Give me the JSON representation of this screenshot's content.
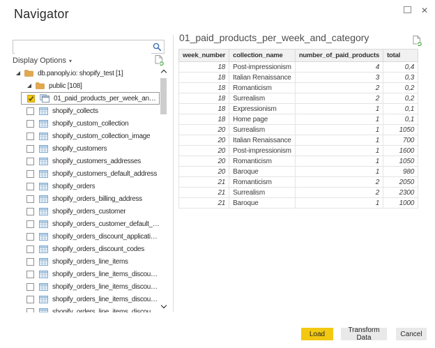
{
  "window": {
    "title": "Navigator",
    "close_glyph": "✕"
  },
  "search": {
    "value": "",
    "placeholder": ""
  },
  "left_panel": {
    "display_options_label": "Display Options",
    "display_options_caret": "▾",
    "tree": [
      {
        "label": "db.panoply.io: shopify_test [1]",
        "type": "folder",
        "level": 0,
        "expanded": true
      },
      {
        "label": "public [108]",
        "type": "folder",
        "level": 1,
        "expanded": true
      },
      {
        "label": "01_paid_products_per_week_and_cat...",
        "type": "view",
        "level": 2,
        "checked": true,
        "selected": true
      },
      {
        "label": "shopify_collects",
        "type": "table",
        "level": 2,
        "checked": false
      },
      {
        "label": "shopify_custom_collection",
        "type": "table",
        "level": 2,
        "checked": false
      },
      {
        "label": "shopify_custom_collection_image",
        "type": "table",
        "level": 2,
        "checked": false
      },
      {
        "label": "shopify_customers",
        "type": "table",
        "level": 2,
        "checked": false
      },
      {
        "label": "shopify_customers_addresses",
        "type": "table",
        "level": 2,
        "checked": false
      },
      {
        "label": "shopify_customers_default_address",
        "type": "table",
        "level": 2,
        "checked": false
      },
      {
        "label": "shopify_orders",
        "type": "table",
        "level": 2,
        "checked": false
      },
      {
        "label": "shopify_orders_billing_address",
        "type": "table",
        "level": 2,
        "checked": false
      },
      {
        "label": "shopify_orders_customer",
        "type": "table",
        "level": 2,
        "checked": false
      },
      {
        "label": "shopify_orders_customer_default_ad...",
        "type": "table",
        "level": 2,
        "checked": false
      },
      {
        "label": "shopify_orders_discount_applications",
        "type": "table",
        "level": 2,
        "checked": false
      },
      {
        "label": "shopify_orders_discount_codes",
        "type": "table",
        "level": 2,
        "checked": false
      },
      {
        "label": "shopify_orders_line_items",
        "type": "table",
        "level": 2,
        "checked": false
      },
      {
        "label": "shopify_orders_line_items_discount_a...",
        "type": "table",
        "level": 2,
        "checked": false
      },
      {
        "label": "shopify_orders_line_items_discount_a...",
        "type": "table",
        "level": 2,
        "checked": false
      },
      {
        "label": "shopify_orders_line_items_discount_a...",
        "type": "table",
        "level": 2,
        "checked": false
      },
      {
        "label": "shopify_orders_line_items_discount_a...",
        "type": "table",
        "level": 2,
        "checked": false
      }
    ]
  },
  "preview": {
    "title": "01_paid_products_per_week_and_category",
    "table": {
      "columns": [
        "week_number",
        "collection_name",
        "number_of_paid_products",
        "total"
      ],
      "rows": [
        [
          "18",
          "Post-impressionism",
          "4",
          "0,4"
        ],
        [
          "18",
          "Italian Renaissance",
          "3",
          "0,3"
        ],
        [
          "18",
          "Romanticism",
          "2",
          "0,2"
        ],
        [
          "18",
          "Surrealism",
          "2",
          "0,2"
        ],
        [
          "18",
          "Expressionism",
          "1",
          "0,1"
        ],
        [
          "18",
          "Home page",
          "1",
          "0,1"
        ],
        [
          "20",
          "Surrealism",
          "1",
          "1050"
        ],
        [
          "20",
          "Italian Renaissance",
          "1",
          "700"
        ],
        [
          "20",
          "Post-impressionism",
          "1",
          "1600"
        ],
        [
          "20",
          "Romanticism",
          "1",
          "1050"
        ],
        [
          "20",
          "Baroque",
          "1",
          "980"
        ],
        [
          "21",
          "Romanticism",
          "2",
          "2050"
        ],
        [
          "21",
          "Surrealism",
          "2",
          "2300"
        ],
        [
          "21",
          "Baroque",
          "1",
          "1000"
        ]
      ]
    }
  },
  "footer": {
    "load_label": "Load",
    "transform_label": "Transform Data",
    "cancel_label": "Cancel"
  },
  "colors": {
    "accent_yellow": "#F2C811",
    "folder_amber": "#E2A94E",
    "table_icon_blue": "#79A6CF",
    "search_blue": "#3D6EB4",
    "refresh_green": "#3BA23B",
    "button_gray": "#E9E9E9"
  }
}
